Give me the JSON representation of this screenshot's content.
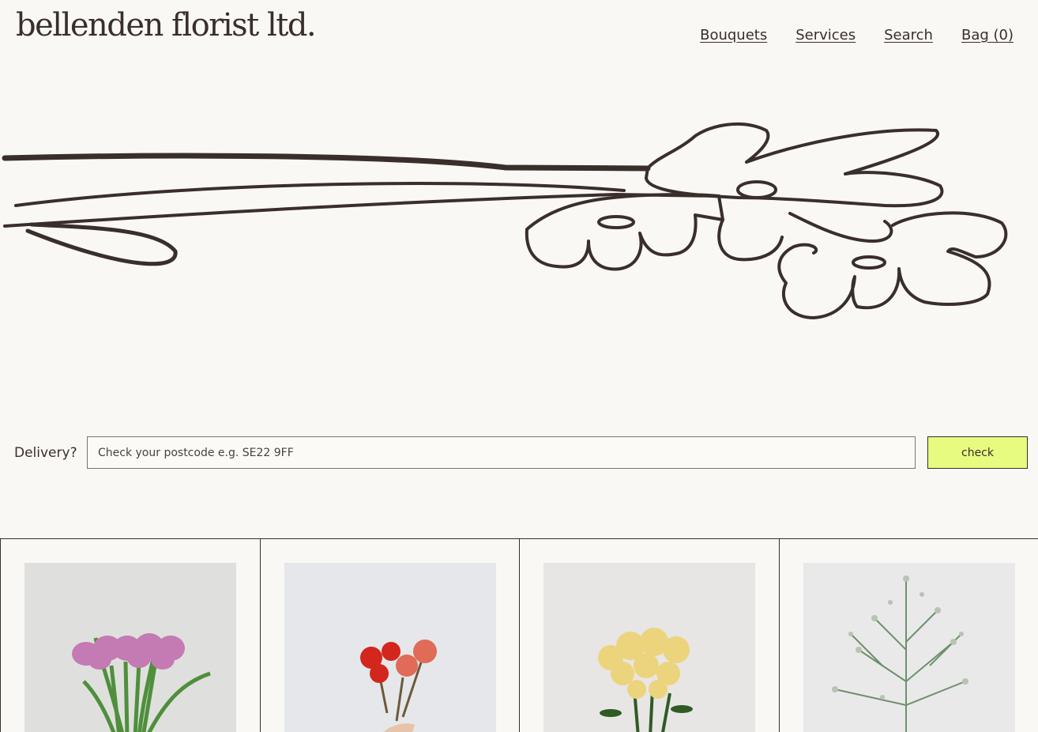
{
  "brand": {
    "logo_text": "bellenden florist ltd."
  },
  "nav": {
    "items": [
      {
        "label": "Bouquets"
      },
      {
        "label": "Services"
      },
      {
        "label": "Search"
      },
      {
        "label": "Bag (0)"
      }
    ]
  },
  "hero": {
    "illustration": "line-drawing-flowers-illustration"
  },
  "delivery": {
    "label": "Delivery?",
    "input_placeholder": "Check your postcode e.g. SE22 9FF",
    "input_value": "",
    "button_label": "check",
    "button_color": "#e7fb80"
  },
  "products": [
    {
      "photo": "pink-tulips-photo"
    },
    {
      "photo": "red-roses-photo"
    },
    {
      "photo": "yellow-chrysanthemums-photo"
    },
    {
      "photo": "limonium-photo"
    }
  ],
  "colors": {
    "background": "#f9f8f4",
    "ink": "#3a2e2b",
    "accent": "#e7fb80"
  }
}
